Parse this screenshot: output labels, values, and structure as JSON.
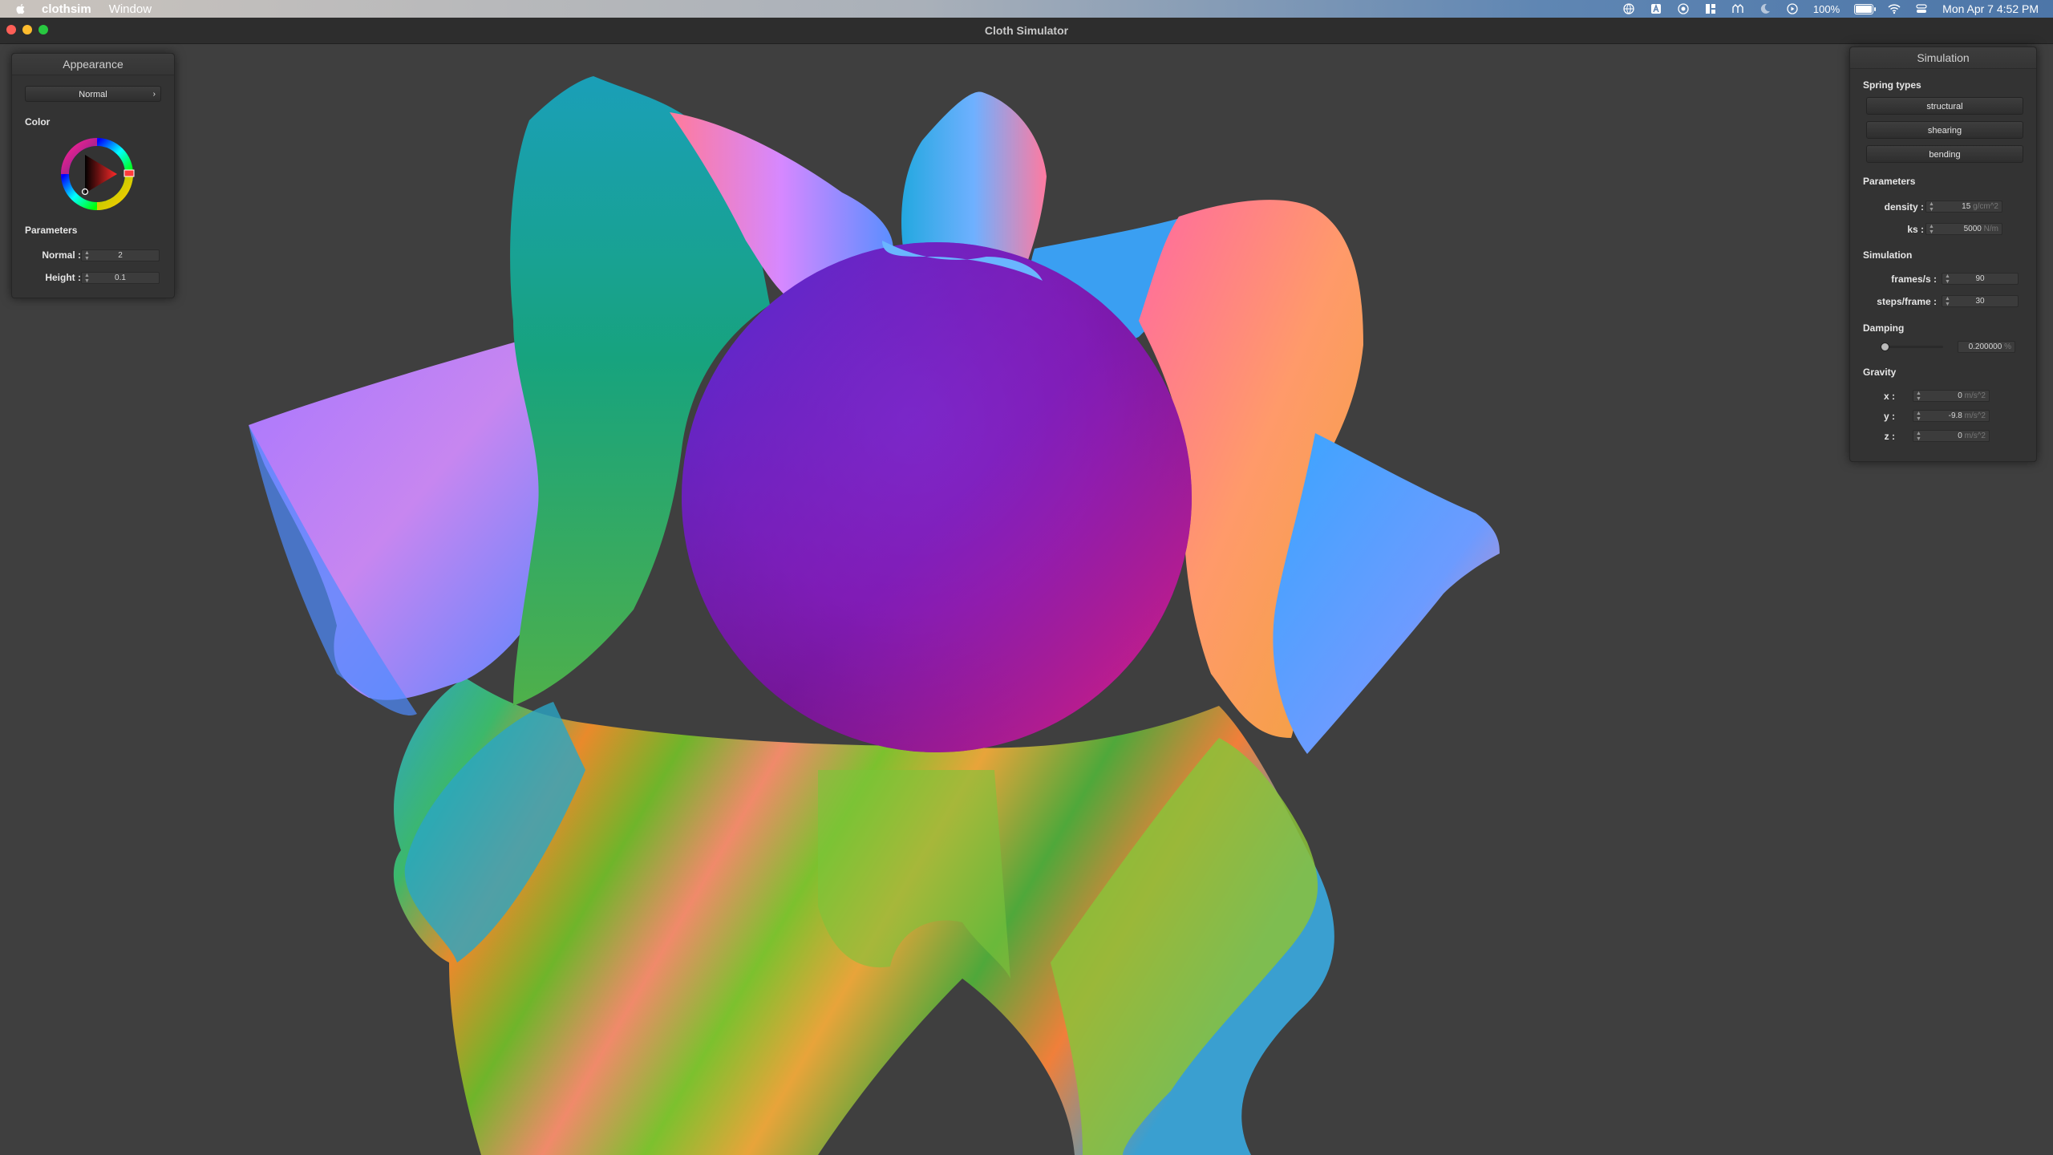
{
  "menubar": {
    "app_name": "clothsim",
    "menu_window": "Window",
    "battery_percent": "100%",
    "datetime": "Mon Apr 7  4:52 PM",
    "icons": [
      "apple-icon",
      "globe-icon",
      "text-input-icon",
      "screen-record-icon",
      "control-icon",
      "airdrop-icon",
      "moon-icon",
      "play-icon",
      "battery-icon",
      "wifi-icon",
      "control-center-icon"
    ]
  },
  "window": {
    "title": "Cloth Simulator"
  },
  "appearance": {
    "title": "Appearance",
    "shader": "Normal",
    "color_label": "Color",
    "params_label": "Parameters",
    "normal_label": "Normal :",
    "normal_value": "2",
    "height_label": "Height :",
    "height_value": "0.1"
  },
  "simulation": {
    "title": "Simulation",
    "spring_types_label": "Spring types",
    "structural": "structural",
    "shearing": "shearing",
    "bending": "bending",
    "parameters_label": "Parameters",
    "density_label": "density :",
    "density_value": "15",
    "density_unit": "g/cm^2",
    "ks_label": "ks :",
    "ks_value": "5000",
    "ks_unit": "N/m",
    "sim_label": "Simulation",
    "fps_label": "frames/s :",
    "fps_value": "90",
    "steps_label": "steps/frame :",
    "steps_value": "30",
    "damping_label": "Damping",
    "damping_value": "0.200000",
    "damping_unit": "%",
    "damping_fraction": 0.02,
    "gravity_label": "Gravity",
    "gx_label": "x :",
    "gx_value": "0",
    "gy_label": "y :",
    "gy_value": "-9.8",
    "gz_label": "z :",
    "gz_value": "0",
    "gravity_unit": "m/s^2"
  },
  "colors": {
    "background": "#3f3f3f",
    "sphere_top": "#4b2fd9",
    "sphere_bottom": "#e0208a"
  }
}
